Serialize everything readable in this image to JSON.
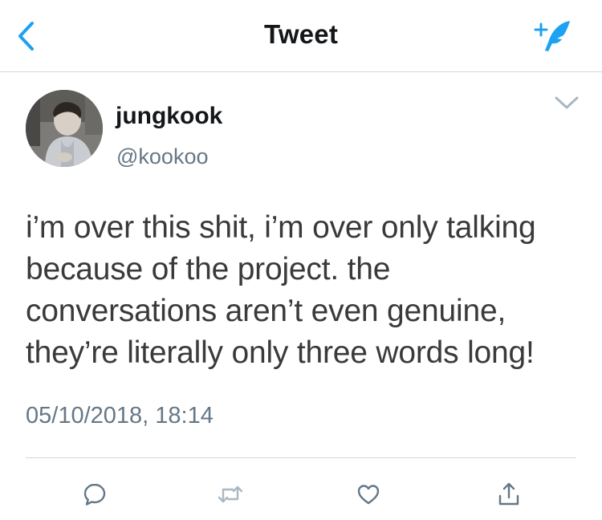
{
  "header": {
    "title": "Tweet",
    "back_icon": "chevron-left-icon",
    "compose_icon": "compose-tweet-icon",
    "accent_color": "#1da1f2"
  },
  "tweet": {
    "display_name": "jungkook",
    "handle": "@kookoo",
    "text": "i’m over this shit, i’m over only talking because of the project. the conversations aren’t even genuine, they’re literally only three words long!",
    "timestamp": "05/10/2018, 18:14",
    "menu_icon": "chevron-down-icon"
  },
  "actions": [
    {
      "name": "reply",
      "icon": "reply-icon"
    },
    {
      "name": "retweet",
      "icon": "retweet-icon"
    },
    {
      "name": "like",
      "icon": "heart-icon"
    },
    {
      "name": "share",
      "icon": "share-icon"
    }
  ]
}
